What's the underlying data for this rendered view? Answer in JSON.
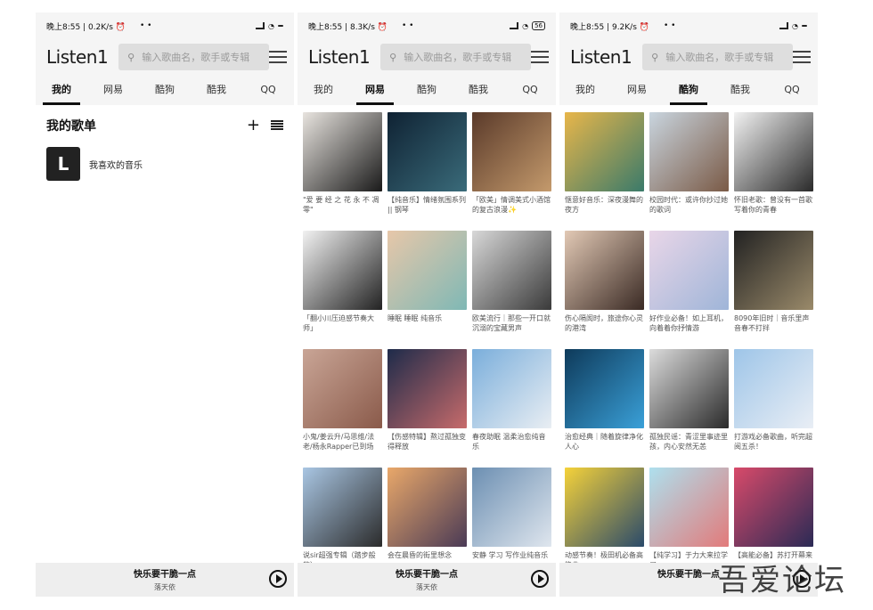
{
  "screens": [
    {
      "status": {
        "time": "晚上8:55 | 0.2K/s ⏰",
        "dots": "• •",
        "battery": ""
      },
      "app_title": "Listen1",
      "search_placeholder": "输入歌曲名，歌手或专辑",
      "tabs": [
        "我的",
        "网易",
        "酷狗",
        "酷我",
        "QQ"
      ],
      "active_tab": 0,
      "section_title": "我的歌单",
      "playlists": [
        {
          "icon_glyph": "L",
          "name": "我喜欢的音乐"
        }
      ],
      "now_playing": {
        "title": "快乐要干脆一点",
        "artist": "落天依"
      }
    },
    {
      "status": {
        "time": "晚上8:55 | 8.3K/s ⏰",
        "dots": "• •",
        "battery": "56"
      },
      "app_title": "Listen1",
      "search_placeholder": "输入歌曲名，歌手或专辑",
      "tabs": [
        "我的",
        "网易",
        "酷狗",
        "酷我",
        "QQ"
      ],
      "active_tab": 1,
      "cards": [
        {
          "caption": "\"爱 要 经 之 花 永 不 凋 零\"",
          "c1": "#e8e4df",
          "c2": "#1a1a1a"
        },
        {
          "caption": "【纯音乐】情绪氛围系列 || 钢琴",
          "c1": "#0f2233",
          "c2": "#3a6b7a"
        },
        {
          "caption": "「欧美」情调美式小酒馆的复古浪漫✨",
          "c1": "#5a3a2a",
          "c2": "#c49a6c"
        },
        {
          "caption": "「翻小川压迫感节奏大师」",
          "c1": "#f2f2f2",
          "c2": "#222222"
        },
        {
          "caption": "睡眠 睡眠 纯音乐",
          "c1": "#e7c7a9",
          "c2": "#7fb8b5"
        },
        {
          "caption": "欧美流行｜那些一开口就沉溺的宝藏男声",
          "c1": "#d8d8d8",
          "c2": "#3a3a3a"
        },
        {
          "caption": "小鬼/姜云升/马思维/法老/杨永Rapper已到场",
          "c1": "#c9a596",
          "c2": "#8a5a4a"
        },
        {
          "caption": "【伤感特辑】熬过孤独变得释放",
          "c1": "#1e2b4a",
          "c2": "#c76b6b"
        },
        {
          "caption": "春夜助眠 温柔治愈纯音乐",
          "c1": "#7aaedb",
          "c2": "#e9eef3"
        },
        {
          "caption": "说sir超强专辑（踏步般的）",
          "c1": "#a9c6e3",
          "c2": "#2b2b2b"
        },
        {
          "caption": "会在晨昏的街里想念",
          "c1": "#e9a86a",
          "c2": "#4a3a55"
        },
        {
          "caption": "安静 学习 写作业纯音乐",
          "c1": "#6c8fb2",
          "c2": "#dfe6ee"
        }
      ],
      "now_playing": {
        "title": "快乐要干脆一点",
        "artist": "落天依"
      }
    },
    {
      "status": {
        "time": "晚上8:55 | 9.2K/s ⏰",
        "dots": "• •",
        "battery": ""
      },
      "app_title": "Listen1",
      "search_placeholder": "输入歌曲名，歌手或专辑",
      "tabs": [
        "我的",
        "网易",
        "酷狗",
        "酷我",
        "QQ"
      ],
      "active_tab": 2,
      "cards": [
        {
          "caption": "惬意好音乐：深夜漫舞的夜方",
          "c1": "#e8b64a",
          "c2": "#3a7a6a"
        },
        {
          "caption": "校园时代：或许你抄过她的歌词",
          "c1": "#c9d5df",
          "c2": "#7a5a46"
        },
        {
          "caption": "怀旧老歌：曾没有一首歌写着你的青春",
          "c1": "#f2f2f2",
          "c2": "#2a2a2a"
        },
        {
          "caption": "伤心隔阂时，旅途你心灵的港湾",
          "c1": "#e2c9b5",
          "c2": "#3a2a24"
        },
        {
          "caption": "好作业必备！如上耳机，向着着你抒情游",
          "c1": "#e9d6e8",
          "c2": "#9fb5d8"
        },
        {
          "caption": "8090年旧时｜音乐里声音春不打拌",
          "c1": "#222222",
          "c2": "#9a8a6a"
        },
        {
          "caption": "治愈经典｜随着旋律净化人心",
          "c1": "#0e3a5a",
          "c2": "#3aa0d8"
        },
        {
          "caption": "孤独民谣：青涩里事迹里孩，内心安然无恙",
          "c1": "#dcdcdc",
          "c2": "#2a2a2a"
        },
        {
          "caption": "打游戏必备歌曲，听完超阅五杀！",
          "c1": "#9ec5e8",
          "c2": "#e9eef5"
        },
        {
          "caption": "动感节奏！极田机必备高能曲",
          "c1": "#f5d23a",
          "c2": "#2a4a6a"
        },
        {
          "caption": "【纯学习】于力大来拉学习",
          "c1": "#aee0ee",
          "c2": "#e27a7a"
        },
        {
          "caption": "【高能必备】苏打开幕来",
          "c1": "#d84a6a",
          "c2": "#2a2a55"
        }
      ],
      "now_playing": {
        "title": "快乐要干脆一点",
        "artist": ""
      }
    }
  ],
  "watermark": "吾爱论坛"
}
